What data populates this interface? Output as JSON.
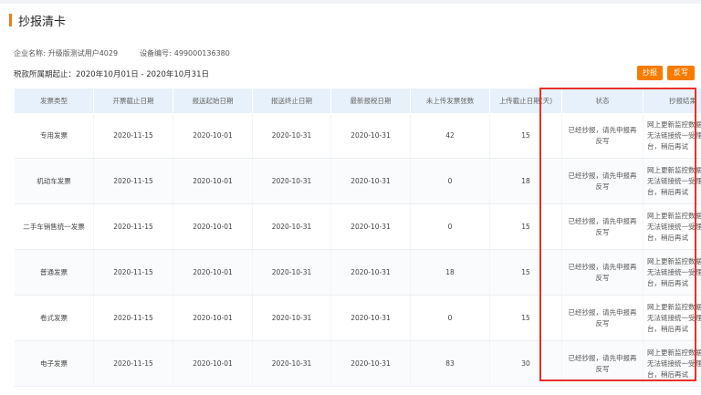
{
  "page": {
    "title": "抄报清卡"
  },
  "info": {
    "company_label": "企业名称:",
    "company_name": "升级版测试用户4029",
    "device_label": "设备编号:",
    "device_no": "499000136380"
  },
  "period": {
    "text": "税款所属期起止：2020年10月01日 - 2020年10月31日"
  },
  "buttons": {
    "copy": "抄报",
    "clear": "反写"
  },
  "colors": {
    "accent": "#f57c00",
    "highlight": "#e8302a",
    "header_bg": "#e7f1fb"
  },
  "table": {
    "headers": [
      "发票类型",
      "开票截止日期",
      "报送起始日期",
      "报送终止日期",
      "最新报税日期",
      "未上传发票张数",
      "上传截止日期(天)",
      "状态",
      "抄报结果"
    ],
    "rows": [
      [
        "专用发票",
        "2020-11-15",
        "2020-10-01",
        "2020-10-31",
        "2020-10-31",
        "42",
        "15",
        "已经抄报，请先申报再反写",
        "网上更新监控数据结果:无法链接统一受理平台，稍后再试"
      ],
      [
        "机动车发票",
        "2020-11-15",
        "2020-10-01",
        "2020-10-31",
        "2020-10-31",
        "0",
        "18",
        "已经抄报，请先申报再反写",
        "网上更新监控数据结果:无法链接统一受理平台，稍后再试"
      ],
      [
        "二手车销售统一发票",
        "2020-11-15",
        "2020-10-01",
        "2020-10-31",
        "2020-10-31",
        "0",
        "15",
        "已经抄报，请先申报再反写",
        "网上更新监控数据结果:无法链接统一受理平台，稍后再试"
      ],
      [
        "普通发票",
        "2020-11-15",
        "2020-10-01",
        "2020-10-31",
        "2020-10-31",
        "18",
        "15",
        "已经抄报，请先申报再反写",
        "网上更新监控数据结果:无法链接统一受理平台，稍后再试"
      ],
      [
        "卷式发票",
        "2020-11-15",
        "2020-10-01",
        "2020-10-31",
        "2020-10-31",
        "0",
        "15",
        "已经抄报，请先申报再反写",
        "网上更新监控数据结果:无法链接统一受理平台，稍后再试"
      ],
      [
        "电子发票",
        "2020-11-15",
        "2020-10-01",
        "2020-10-31",
        "2020-10-31",
        "83",
        "30",
        "已经抄报，请先申报再反写",
        "网上更新监控数据结果:无法链接统一受理平台，稍后再试"
      ]
    ]
  }
}
